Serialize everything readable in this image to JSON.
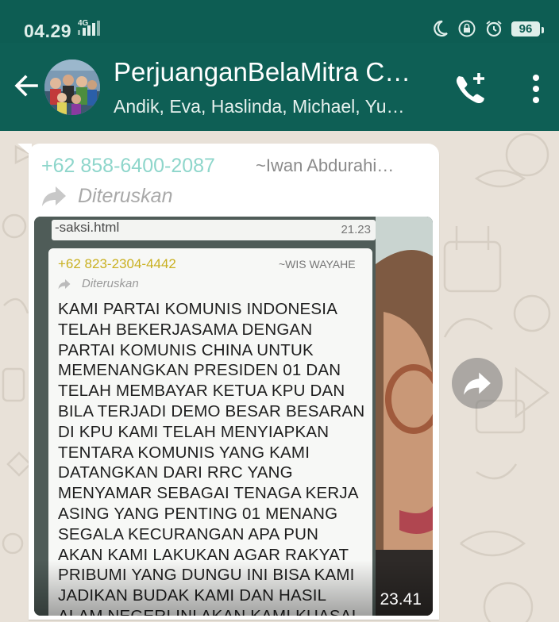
{
  "status_bar": {
    "time": "04.29",
    "network": "4G",
    "battery": "96",
    "icons": [
      "moon-icon",
      "lock-rotate-icon",
      "alarm-icon",
      "battery-icon"
    ]
  },
  "header": {
    "title": "PerjuanganBelaMitra C…",
    "subtitle": "Andik, Eva, Haslinda, Michael, Yu…",
    "icons": [
      "back-arrow-icon",
      "add-call-icon",
      "more-vert-icon"
    ]
  },
  "message": {
    "sender_phone": "+62 858-6400-2087",
    "sender_name": "~Iwan Abdurahi…",
    "forwarded_label": "Diteruskan",
    "time": "23.41",
    "image": {
      "top_strip_text": "-saksi.html",
      "top_strip_time": "21.23",
      "inner_phone": "+62 823-2304-4442",
      "inner_name": "~WIS WAYAHE",
      "inner_forwarded": "Diteruskan",
      "inner_text": "KAMI PARTAI KOMUNIS INDONESIA\nTELAH BEKERJASAMA DENGAN\nPARTAI KOMUNIS CHINA UNTUK\nMEMENANGKAN PRESIDEN 01 DAN\nTELAH MEMBAYAR KETUA KPU DAN\nBILA TERJADI DEMO BESAR BESARAN\nDI KPU KAMI TELAH MENYIAPKAN\nTENTARA KOMUNIS YANG KAMI\nDATANGKAN DARI RRC YANG\nMENYAMAR SEBAGAI TENAGA KERJA\nASING YANG PENTING 01 MENANG\nSEGALA KECURANGAN APA PUN\nAKAN KAMI LAKUKAN AGAR RAKYAT\nPRIBUMI YANG DUNGU INI BISA KAMI\nJADIKAN BUDAK KAMI DAN HASIL\nALAM NEGERI INI AKAN KAMI KUASAI"
    }
  },
  "colors": {
    "header_bg": "#0e5f55",
    "status_bg": "#0d5d53",
    "sender_phone": "#8ed6cb",
    "wallpaper": "#e8e1d8"
  }
}
